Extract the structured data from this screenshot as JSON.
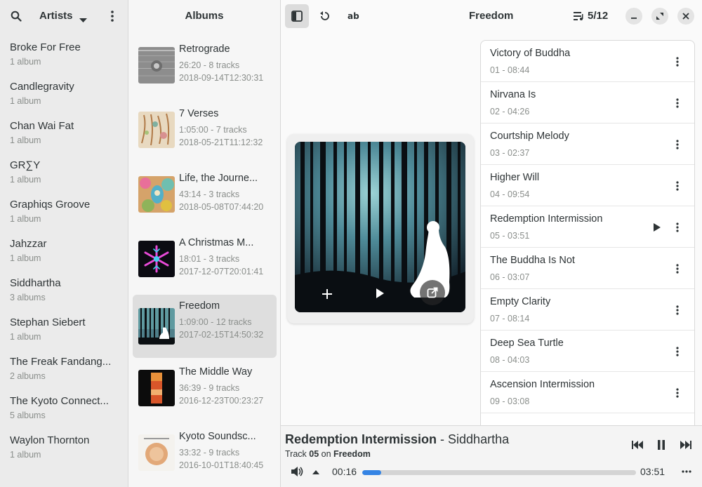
{
  "artists": {
    "title": "Artists",
    "items": [
      {
        "name": "Broke For Free",
        "count": "1 album"
      },
      {
        "name": "Candlegravity",
        "count": "1 album"
      },
      {
        "name": "Chan Wai Fat",
        "count": "1 album"
      },
      {
        "name": "GR∑Y",
        "count": "1 album"
      },
      {
        "name": "Graphiqs Groove",
        "count": "1 album"
      },
      {
        "name": "Jahzzar",
        "count": "1 album"
      },
      {
        "name": "Siddhartha",
        "count": "3 albums"
      },
      {
        "name": "Stephan Siebert",
        "count": "1 album"
      },
      {
        "name": "The Freak Fandang...",
        "count": "2 albums"
      },
      {
        "name": "The Kyoto Connect...",
        "count": "5 albums"
      },
      {
        "name": "Waylon Thornton",
        "count": "1 album"
      }
    ]
  },
  "albums": {
    "title": "Albums",
    "items": [
      {
        "title": "Retrograde",
        "info": "26:20 - 8 tracks",
        "date": "2018-09-14T12:30:31"
      },
      {
        "title": "7 Verses",
        "info": "1:05:00 - 7 tracks",
        "date": "2018-05-21T11:12:32"
      },
      {
        "title": "Life, the Journe...",
        "info": "43:14 - 3 tracks",
        "date": "2018-05-08T07:44:20"
      },
      {
        "title": "A Christmas M...",
        "info": "18:01 - 3 tracks",
        "date": "2017-12-07T20:01:41"
      },
      {
        "title": "Freedom",
        "info": "1:09:00 - 12 tracks",
        "date": "2017-02-15T14:50:32"
      },
      {
        "title": "The Middle Way",
        "info": "36:39 - 9 tracks",
        "date": "2016-12-23T00:23:27"
      },
      {
        "title": "Kyoto Soundsc...",
        "info": "33:32 - 9 tracks",
        "date": "2016-10-01T18:40:45"
      }
    ]
  },
  "main": {
    "title": "Freedom",
    "queue_position": "5/12"
  },
  "tracks": [
    {
      "name": "Victory of Buddha",
      "meta": "01 - 08:44"
    },
    {
      "name": "Nirvana Is",
      "meta": "02 - 04:26"
    },
    {
      "name": "Courtship Melody",
      "meta": "03 - 02:37"
    },
    {
      "name": "Higher Will",
      "meta": "04 - 09:54"
    },
    {
      "name": "Redemption Intermission",
      "meta": "05 - 03:51"
    },
    {
      "name": "The Buddha Is Not",
      "meta": "06 - 03:07"
    },
    {
      "name": "Empty Clarity",
      "meta": "07 - 08:14"
    },
    {
      "name": "Deep Sea Turtle",
      "meta": "08 - 04:03"
    },
    {
      "name": "Ascension Intermission",
      "meta": "09 - 03:08"
    }
  ],
  "player": {
    "title": "Redemption Intermission",
    "separator": " - ",
    "artist": "Siddhartha",
    "track_prefix": "Track ",
    "track_number": "05",
    "on_word": " on ",
    "album": "Freedom",
    "elapsed": "00:16",
    "total": "03:51",
    "progress": 0.07
  },
  "colors": {
    "accent": "#3584e4",
    "selected_album_bg": "#dedede"
  }
}
